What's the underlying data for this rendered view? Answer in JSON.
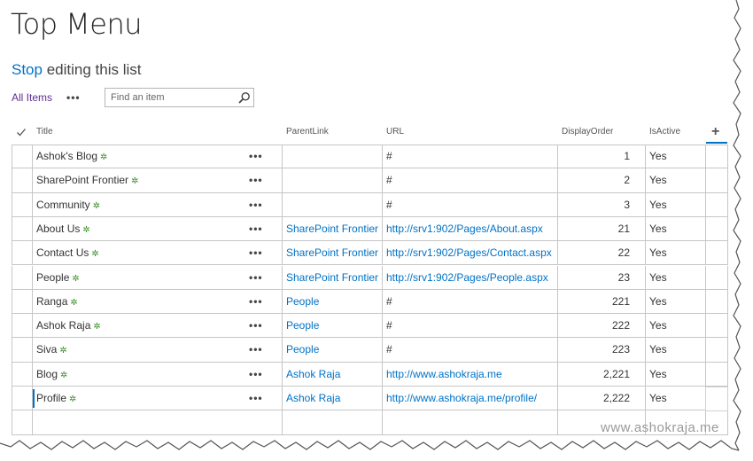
{
  "page": {
    "title": "Top Menu"
  },
  "edit_mode": {
    "stop_label": "Stop",
    "rest_label": " editing this list"
  },
  "toolbar": {
    "view_label": "All Items",
    "more_label": "•••"
  },
  "search": {
    "placeholder": "Find an item",
    "value": ""
  },
  "columns": {
    "title": "Title",
    "parent_link": "ParentLink",
    "url": "URL",
    "display_order": "DisplayOrder",
    "is_active": "IsActive",
    "add_column": "+"
  },
  "rows": [
    {
      "title": "Ashok's Blog",
      "parent_link": "",
      "url": "#",
      "display_order": "1",
      "is_active": "Yes"
    },
    {
      "title": "SharePoint Frontier",
      "parent_link": "",
      "url": "#",
      "display_order": "2",
      "is_active": "Yes"
    },
    {
      "title": "Community",
      "parent_link": "",
      "url": "#",
      "display_order": "3",
      "is_active": "Yes"
    },
    {
      "title": "About Us",
      "parent_link": "SharePoint Frontier",
      "url": "http://srv1:902/Pages/About.aspx",
      "display_order": "21",
      "is_active": "Yes"
    },
    {
      "title": "Contact Us",
      "parent_link": "SharePoint Frontier",
      "url": "http://srv1:902/Pages/Contact.aspx",
      "display_order": "22",
      "is_active": "Yes"
    },
    {
      "title": "People",
      "parent_link": "SharePoint Frontier",
      "url": "http://srv1:902/Pages/People.aspx",
      "display_order": "23",
      "is_active": "Yes"
    },
    {
      "title": "Ranga",
      "parent_link": "People",
      "url": "#",
      "display_order": "221",
      "is_active": "Yes"
    },
    {
      "title": "Ashok Raja",
      "parent_link": "People",
      "url": "#",
      "display_order": "222",
      "is_active": "Yes"
    },
    {
      "title": "Siva",
      "parent_link": "People",
      "url": "#",
      "display_order": "223",
      "is_active": "Yes"
    },
    {
      "title": "Blog",
      "parent_link": "Ashok Raja",
      "url": "http://www.ashokraja.me",
      "display_order": "2,221",
      "is_active": "Yes"
    },
    {
      "title": "Profile",
      "parent_link": "Ashok Raja",
      "url": "http://www.ashokraja.me/profile/",
      "display_order": "2,222",
      "is_active": "Yes"
    }
  ],
  "row_menu_label": "•••",
  "new_item_icon": "✲",
  "watermark": "www.ashokraja.me",
  "colors": {
    "accent": "#0072c6",
    "view_link": "#5f2d91",
    "new_icon": "#3c8d2b"
  }
}
